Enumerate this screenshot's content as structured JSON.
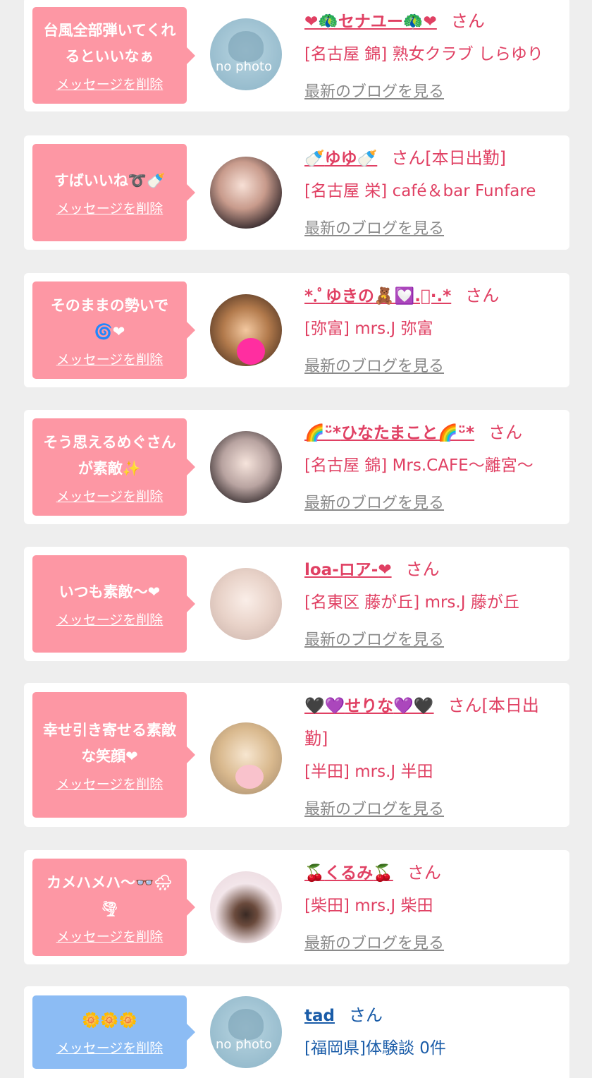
{
  "colors": {
    "bubble_pink": "#fd97a4",
    "bubble_blue": "#8cbcf4",
    "name_pink": "#e04063",
    "name_blue": "#1a5ca8",
    "link_gray": "#8a8a8a"
  },
  "entries": [
    {
      "message": "台風全部弾いてくれるといいなぁ",
      "delete": "メッセージを削除",
      "name_pre": "❤🦚",
      "name": "セナユー",
      "name_post": "🦚❤",
      "suffix": "さん",
      "shop": "[名古屋 錦] 熟女クラブ しらゆり",
      "blog": "最新のブログを見る",
      "avatar": "no-photo",
      "photo_text": "no photo"
    },
    {
      "message": "すばいいね➰🍼",
      "delete": "メッセージを削除",
      "name_pre": "🍼",
      "name": "ゆゆ",
      "name_post": "🍼",
      "suffix": "さん[本日出勤]",
      "shop": "[名古屋 栄] café＆bar Funfare",
      "blog": "最新のブログを見る",
      "avatar": "photo"
    },
    {
      "message": "そのままの勢いで🌀❤",
      "delete": "メッセージを削除",
      "name_pre": "*.ﾟ",
      "name": "ゆきの",
      "name_post": "🧸💟.ﾟ·.*",
      "suffix": "さん",
      "shop": "[弥富] mrs.J 弥富",
      "blog": "最新のブログを見る",
      "avatar": "photo"
    },
    {
      "message": "そう思えるめぐさんが素敵✨",
      "delete": "メッセージを削除",
      "name_pre": "🌈ᵕ̈*",
      "name": "ひなたまこと",
      "name_post": "🌈ᵕ̈*",
      "suffix": "さん",
      "shop": "[名古屋 錦] Mrs.CAFE～離宮～",
      "blog": "最新のブログを見る",
      "avatar": "photo"
    },
    {
      "message": "いつも素敵～❤",
      "delete": "メッセージを削除",
      "name_pre": "",
      "name": "loa-ロア-",
      "name_post": "❤",
      "suffix": "さん",
      "shop": "[名東区 藤が丘] mrs.J 藤が丘",
      "blog": "最新のブログを見る",
      "avatar": "photo"
    },
    {
      "message": "幸せ引き寄せる素敵な笑顔❤",
      "delete": "メッセージを削除",
      "name_pre": "🖤💜",
      "name": "せりな",
      "name_post": "💜🖤",
      "suffix": "さん[本日出勤]",
      "shop": "[半田] mrs.J 半田",
      "blog": "最新のブログを見る",
      "avatar": "photo"
    },
    {
      "message": "カメハメハ～👓🌧🌪",
      "delete": "メッセージを削除",
      "name_pre": "🍒",
      "name": "くるみ",
      "name_post": "🍒",
      "suffix": "さん",
      "shop": "[柴田] mrs.J 柴田",
      "blog": "最新のブログを見る",
      "avatar": "photo"
    },
    {
      "message": "🌼🌼🌼",
      "delete": "メッセージを削除",
      "name_pre": "",
      "name": "tad",
      "name_post": "",
      "suffix": "さん",
      "shop": "[福岡県]体験談 0件",
      "avatar": "no-photo",
      "photo_text": "no photo"
    }
  ]
}
